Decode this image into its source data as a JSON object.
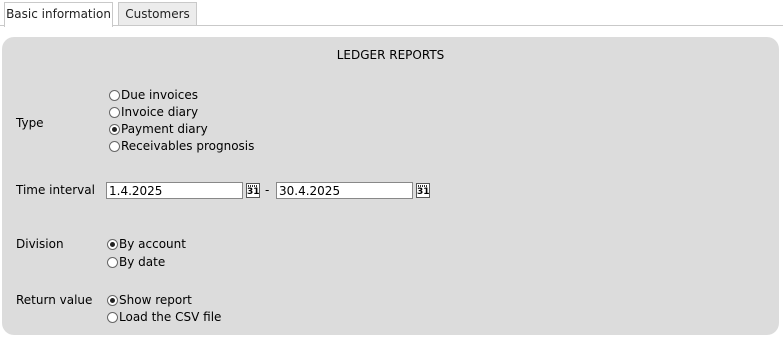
{
  "tabs": [
    {
      "label": "Basic information",
      "active": true
    },
    {
      "label": "Customers",
      "active": false
    }
  ],
  "panel": {
    "title": "LEDGER REPORTS",
    "type": {
      "label": "Type",
      "options": [
        {
          "label": "Due invoices",
          "selected": false
        },
        {
          "label": "Invoice diary",
          "selected": false
        },
        {
          "label": "Payment diary",
          "selected": true
        },
        {
          "label": "Receivables prognosis",
          "selected": false
        }
      ]
    },
    "time_interval": {
      "label": "Time interval",
      "from": "1.4.2025",
      "to": "30.4.2025",
      "separator": "-",
      "calendar_text": "31"
    },
    "division": {
      "label": "Division",
      "options": [
        {
          "label": "By account",
          "selected": true
        },
        {
          "label": "By date",
          "selected": false
        }
      ]
    },
    "return_value": {
      "label": "Return value",
      "options": [
        {
          "label": "Show report",
          "selected": true
        },
        {
          "label": "Load the CSV file",
          "selected": false
        }
      ]
    }
  },
  "colors": {
    "panel_bg": "#dcdcdc",
    "tab_border": "#c9c9c9"
  }
}
